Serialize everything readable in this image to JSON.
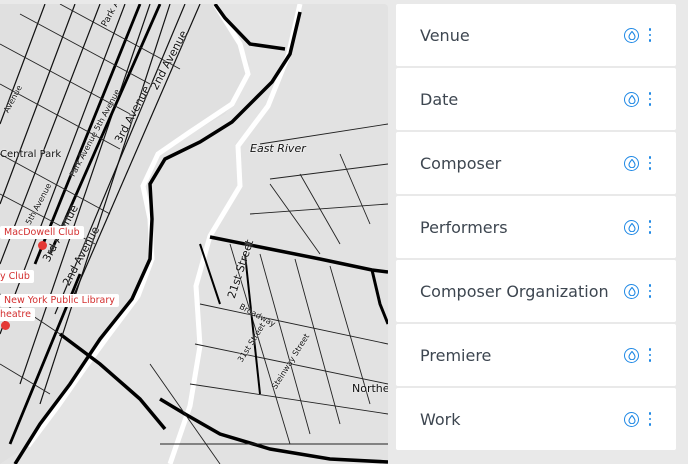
{
  "map": {
    "labels": {
      "east_river": "East River",
      "park_avenue_1": "Park Avenue",
      "park_avenue_2": "Park Avenue",
      "second_avenue_1": "2nd Avenue",
      "second_avenue_2": "2nd Avenue",
      "third_avenue_1": "3rd Avenue",
      "third_avenue_2": "3rd Avenue",
      "fifth_avenue": "Park Avenue 5th Avenue",
      "avenue_partial": "Avenue",
      "central_park": "Central Park",
      "fifth_ave_partial": "5th Avenue",
      "twenty_first_street": "21st Street",
      "broadway": "Broadway",
      "thirty_first_street": "31st Street",
      "steinway_street": "Steinway Street",
      "northern": "Northe"
    },
    "venues": [
      {
        "name": "MacDowell Club"
      },
      {
        "name": "y Club"
      },
      {
        "name": "New York Public Library"
      },
      {
        "name": "heatre"
      }
    ]
  },
  "panel": {
    "rows": [
      {
        "label": "Venue"
      },
      {
        "label": "Date"
      },
      {
        "label": "Composer"
      },
      {
        "label": "Performers"
      },
      {
        "label": "Composer Organization"
      },
      {
        "label": "Premiere"
      },
      {
        "label": "Work"
      }
    ]
  },
  "colors": {
    "accent": "#1e88e5",
    "marker": "#e53935",
    "label_text": "#3d4650"
  }
}
